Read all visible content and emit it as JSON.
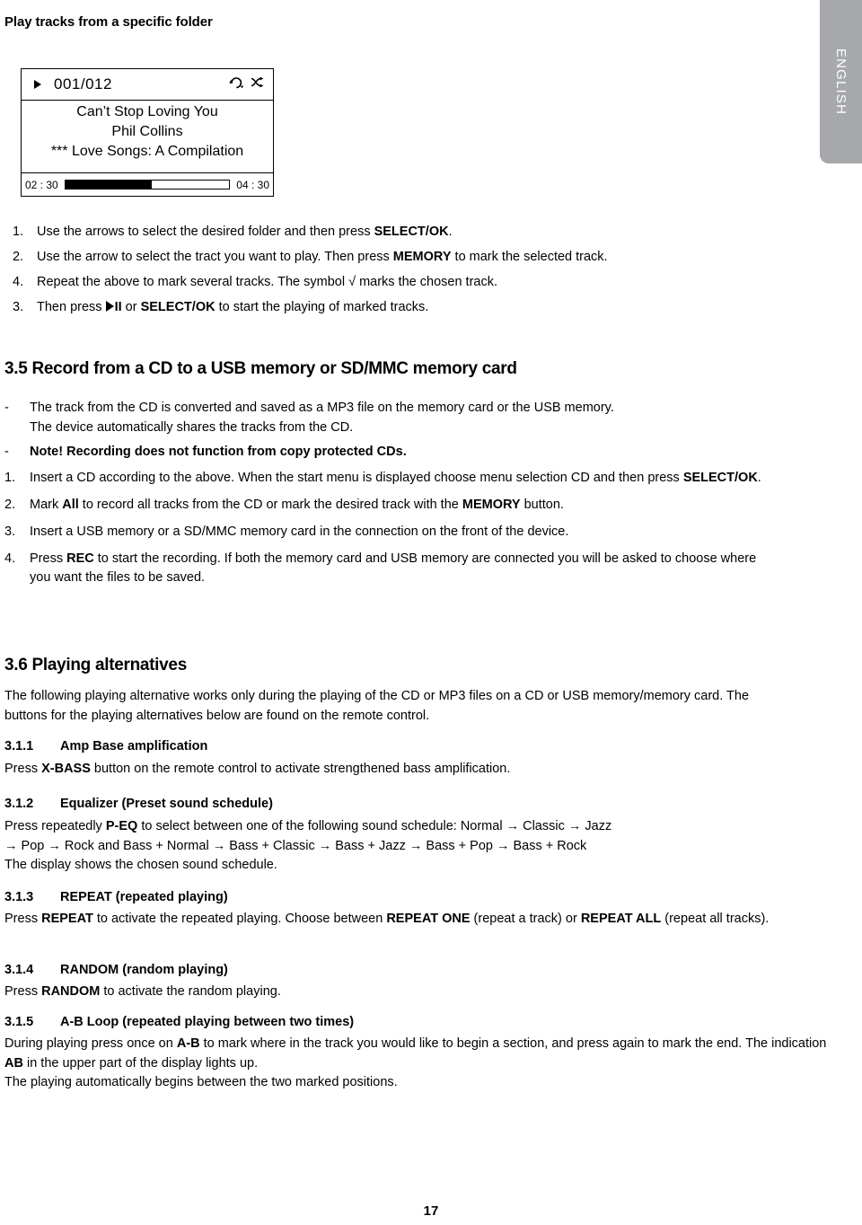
{
  "page": {
    "title": "Play tracks from a specific folder",
    "page_number": "17",
    "language_tab": "ENGLISH"
  },
  "lcd_display": {
    "play_icon": "play-triangle-icon",
    "track_number": "001/012",
    "status_icons": [
      "repeat-icon",
      "shuffle-icon"
    ],
    "track_title": "Can’t Stop Loving You",
    "artist": "Phil Collins",
    "album": "*** Love Songs: A Compilation",
    "elapsed_time": "02 : 30",
    "total_time": "04 : 30",
    "progress_percent": 53
  },
  "folder_steps": [
    {
      "num": "1.",
      "text_pre": "Use the arrows to select the desired folder and then press ",
      "bold": "SELECT/OK",
      "text_post": "."
    },
    {
      "num": "2.",
      "text_pre": "Use the arrow to select the tract you want to play. Then press ",
      "bold": "MEMORY",
      "text_post": " to mark the selected track."
    },
    {
      "num": "4.",
      "text_pre": "Repeat the above to mark several tracks. The symbol √ marks the chosen track.",
      "bold": "",
      "text_post": ""
    },
    {
      "num": "3.",
      "text_pre": "Then press ",
      "bold": "",
      "text_post": ""
    }
  ],
  "step3_parts": {
    "prefix": "Then press ",
    "pause_glyph": "II",
    "middle": " or  ",
    "bold": "SELECT/OK",
    "suffix": " to start the playing of marked tracks."
  },
  "section_3_5": {
    "heading": "3.5 Record from a CD to a USB memory or SD/MMC memory card",
    "bullets": [
      {
        "marker": "-",
        "line1": "The track from the CD is converted and saved as a MP3 file on the memory card or the USB memory.",
        "line2": "The device automatically shares the tracks from the CD."
      },
      {
        "marker": "-",
        "bold": "Note!",
        "line1": " Recording does not function from copy protected CDs.",
        "line2": ""
      }
    ],
    "steps": [
      {
        "num": "1.",
        "a": "Insert a CD according to the above. When the start menu is displayed choose menu selection CD and then press ",
        "bold": "SELECT/OK",
        "b": "."
      },
      {
        "num": "2.",
        "a": "Mark ",
        "bold": "All",
        "b": " to record all tracks from the CD or mark the desired track with the ",
        "bold2": "MEMORY",
        "c": " button."
      },
      {
        "num": "3.",
        "a": "Insert a USB memory or a SD/MMC memory card in the connection on the front of the device.",
        "bold": "",
        "b": ""
      },
      {
        "num": "4.",
        "a": "Press ",
        "bold": "REC",
        "b": " to start the recording. If both the memory card and USB memory are connected you will be asked to choose where you want the files to be saved."
      }
    ]
  },
  "section_3_6": {
    "heading": "3.6 Playing alternatives",
    "intro": "The following playing alternative works only during the playing of the CD or MP3 files on a CD or USB memory/memory card. The buttons for the playing alternatives below are found on the remote control."
  },
  "sub_3_1_1": {
    "num": "3.1.1",
    "title": "Amp Base amplification",
    "body_pre": "Press ",
    "body_bold": "X-BASS",
    "body_post": " button on the remote control to activate strengthened bass amplification."
  },
  "sub_3_1_2": {
    "num": "3.1.2",
    "title": "Equalizer (Preset sound schedule)",
    "body_pre": "Press repeatedly ",
    "body_bold": "P-EQ",
    "line1_post": " to select between one of the following sound schedule: Normal → Classic → Jazz",
    "line2": "→ Pop → Rock and Bass + Normal → Bass + Classic → Bass + Jazz → Bass + Pop → Bass + Rock",
    "line3": "The display shows the chosen sound schedule."
  },
  "sub_3_1_3": {
    "num": "3.1.3",
    "title": "REPEAT (repeated playing)",
    "body_pre": "Press ",
    "body_bold1": "REPEAT",
    "mid1": " to activate the repeated playing. Choose between ",
    "body_bold2": "REPEAT ONE",
    "mid2": " (repeat a track) or ",
    "body_bold3": "REPEAT ALL",
    "mid3": " (repeat all tracks)."
  },
  "sub_3_1_4": {
    "num": "3.1.4",
    "title": "RANDOM (random playing)",
    "body_pre": "Press ",
    "body_bold": "RANDOM",
    "body_post": " to activate the random playing."
  },
  "sub_3_1_5": {
    "num": "3.1.5",
    "title": "A-B Loop (repeated playing between two times)",
    "body_pre": "During playing press once on ",
    "body_bold1": "A-B",
    "mid1": " to mark where in the track you would like to begin a section, and press again to mark the end. The indication ",
    "body_bold2": "AB",
    "mid2": " in the upper part of the display lights up.",
    "line3": "The playing automatically begins between the two marked positions."
  }
}
